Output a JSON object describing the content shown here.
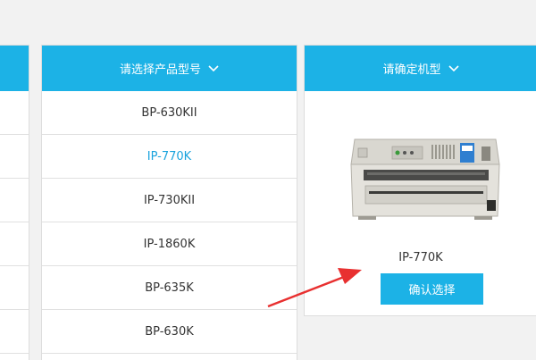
{
  "brand_color": "#1cb2e6",
  "active_color": "#1aa3dd",
  "annotation_color": "#e83030",
  "model_column": {
    "header_label": "请选择产品型号",
    "header_icon": "chevron-down-icon",
    "items": [
      {
        "label": "BP-630KII",
        "selected": false
      },
      {
        "label": "IP-770K",
        "selected": true
      },
      {
        "label": "IP-730KII",
        "selected": false
      },
      {
        "label": "IP-1860K",
        "selected": false
      },
      {
        "label": "BP-635K",
        "selected": false
      },
      {
        "label": "BP-630K",
        "selected": false
      }
    ]
  },
  "confirm_column": {
    "header_label": "请确定机型",
    "header_icon": "chevron-down-icon",
    "product_image": "printer-image",
    "product_name": "IP-770K",
    "confirm_button_label": "确认选择"
  }
}
